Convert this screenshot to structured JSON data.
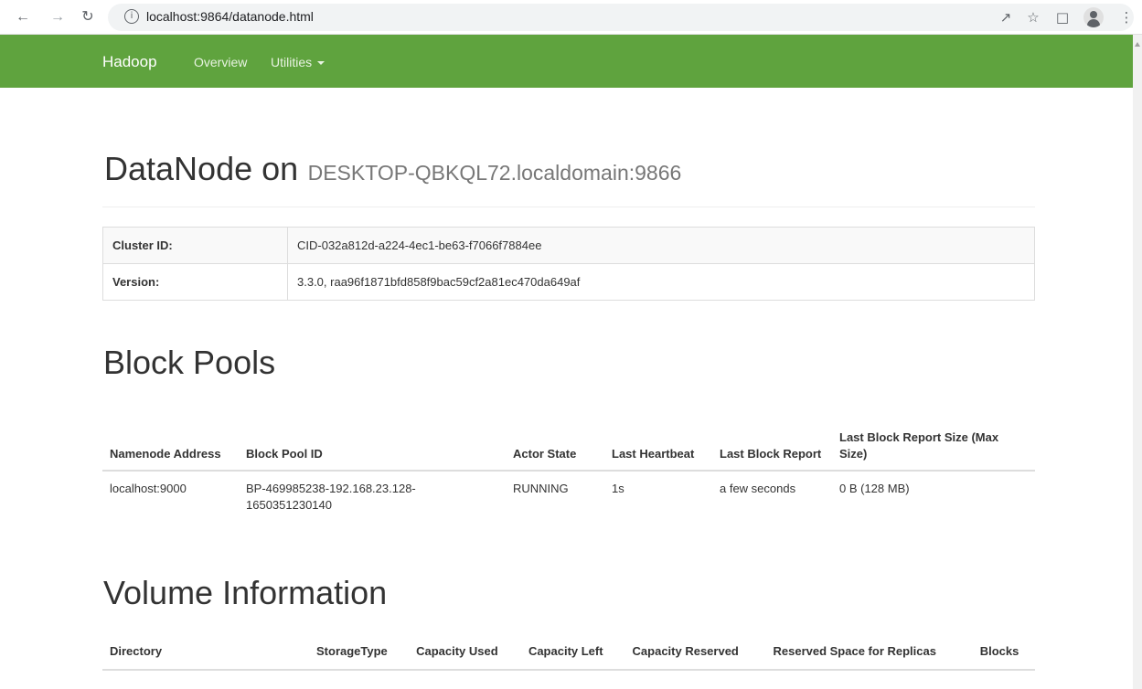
{
  "browser": {
    "url": "localhost:9864/datanode.html",
    "icons": [
      "back-icon",
      "forward-icon",
      "reload-icon",
      "info-icon",
      "share-icon",
      "star-icon",
      "side-panel-icon",
      "profile-icon",
      "menu-icon"
    ]
  },
  "navbar": {
    "brand": "Hadoop",
    "overview": "Overview",
    "utilities": "Utilities",
    "background": "#5fa33e"
  },
  "header": {
    "title": "DataNode on",
    "host": "DESKTOP-QBKQL72.localdomain:9866"
  },
  "info": {
    "rows": [
      {
        "label": "Cluster ID:",
        "value": "CID-032a812d-a224-4ec1-be63-f7066f7884ee"
      },
      {
        "label": "Version:",
        "value": "3.3.0, raa96f1871bfd858f9bac59cf2a81ec470da649af"
      }
    ]
  },
  "block_pools": {
    "title": "Block Pools",
    "headers": [
      "Namenode Address",
      "Block Pool ID",
      "Actor State",
      "Last Heartbeat",
      "Last Block Report",
      "Last Block Report Size (Max Size)"
    ],
    "rows": [
      [
        "localhost:9000",
        "BP-469985238-192.168.23.128-1650351230140",
        "RUNNING",
        "1s",
        "a few seconds",
        "0 B (128 MB)"
      ]
    ]
  },
  "volume_info": {
    "title": "Volume Information",
    "headers": [
      "Directory",
      "StorageType",
      "Capacity Used",
      "Capacity Left",
      "Capacity Reserved",
      "Reserved Space for Replicas",
      "Blocks"
    ]
  }
}
